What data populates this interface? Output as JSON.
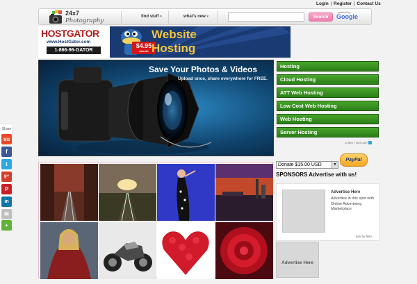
{
  "toplinks": {
    "login": "Login",
    "register": "Register",
    "contact": "Contact Us",
    "separator": "|"
  },
  "header": {
    "logo_text": "24x7",
    "logo_sub": "Photography",
    "nav": [
      {
        "label": "find stuff",
        "arrow": "▾"
      },
      {
        "label": "what's new",
        "arrow": "▾"
      }
    ],
    "search": {
      "value": "",
      "button": "Search"
    },
    "google": {
      "powered": "powered by",
      "label": "Google"
    }
  },
  "hostgator": {
    "name": "HOSTGATOR",
    "url": "www.HostGator.com",
    "phone": "1-866-96-GATOR",
    "price": "$4.95",
    "price_unit": "/month",
    "title_line1": "Website",
    "title_line2": "Hosting"
  },
  "hero": {
    "title": "Save Your Photos & Videos",
    "subtitle": "Upload once, share everywhere for FREE."
  },
  "menu": [
    "Hosting",
    "Cloud Hosting",
    "ATT Web Hosting",
    "Low Cost Web Hosting",
    "Web Hosting",
    "Server Hosting"
  ],
  "adchoices": {
    "label": "Criteo",
    "optout": "Opt out?"
  },
  "donate": {
    "selected": "Donate $15.00 USD",
    "paypal": "PayPal"
  },
  "sponsors": "SPONSORS Advertise with us!",
  "ad": {
    "title": "Advertise Here",
    "text": "Advertise in this spot with Online Advertising Marketplace",
    "credit": "ads by BSA",
    "big_label": "Advertise Here"
  },
  "share": {
    "label": "Share",
    "buttons": [
      {
        "name": "stumbleupon",
        "glyph": "su",
        "color": "#eb4924"
      },
      {
        "name": "facebook",
        "glyph": "f",
        "color": "#3b5998"
      },
      {
        "name": "twitter",
        "glyph": "t",
        "color": "#2ca7e0"
      },
      {
        "name": "google-plus",
        "glyph": "g+",
        "color": "#d23f2f"
      },
      {
        "name": "pinterest",
        "glyph": "P",
        "color": "#cb2027"
      },
      {
        "name": "linkedin",
        "glyph": "in",
        "color": "#0e76a8"
      },
      {
        "name": "email",
        "glyph": "✉",
        "color": "#bfbfbf"
      },
      {
        "name": "more",
        "glyph": "+",
        "color": "#5fb336"
      }
    ]
  },
  "colors": {
    "menu_green": "#3a9120",
    "hostgator_blue": "#1a3a73",
    "search_pink": "#ee7fae"
  }
}
